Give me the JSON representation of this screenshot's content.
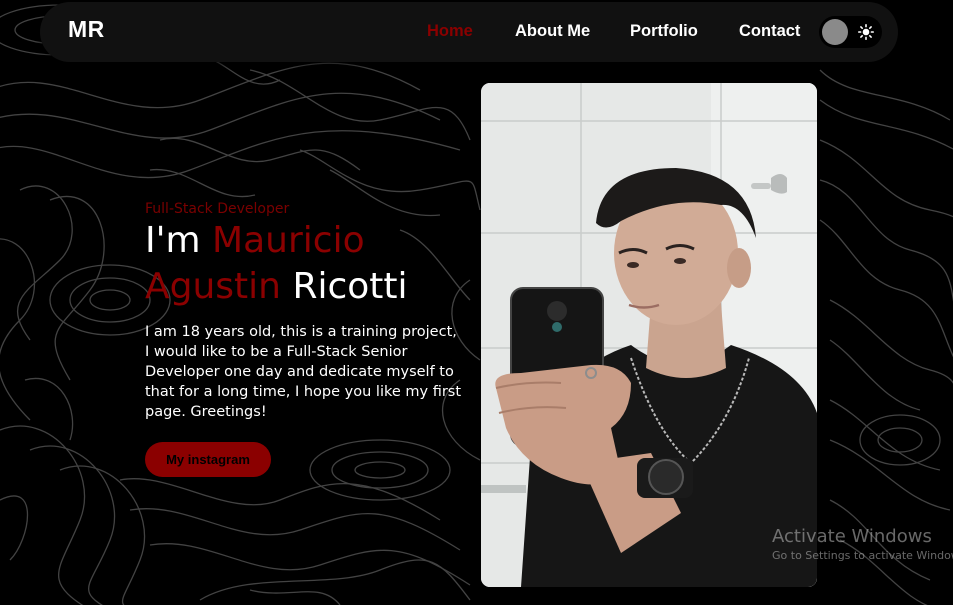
{
  "navbar": {
    "logo": "MR",
    "links": [
      {
        "label": "Home",
        "active": true
      },
      {
        "label": "About Me",
        "active": false
      },
      {
        "label": "Portfolio",
        "active": false
      },
      {
        "label": "Contact",
        "active": false
      }
    ],
    "theme_toggle": {
      "state": "dark",
      "icon": "sun-icon"
    }
  },
  "hero": {
    "subtitle": "Full-Stack Developer",
    "greeting": "I'm ",
    "name_first": "Mauricio",
    "name_middle": "Agustin",
    "name_last": "Ricotti",
    "description": "I am 18 years old, this is a training project, I would like to be a Full-Stack Senior Developer one day and dedicate myself to that for a long time, I hope you like my first page. Greetings!",
    "button_label": "My instagram"
  },
  "photo": {
    "subject": "profile-photo"
  },
  "watermark": {
    "title": "Activate Windows",
    "subtitle": "Go to Settings to activate Windows."
  },
  "colors": {
    "background": "#000000",
    "navbar": "#111111",
    "accent": "#8b0000",
    "text": "#ffffff"
  }
}
